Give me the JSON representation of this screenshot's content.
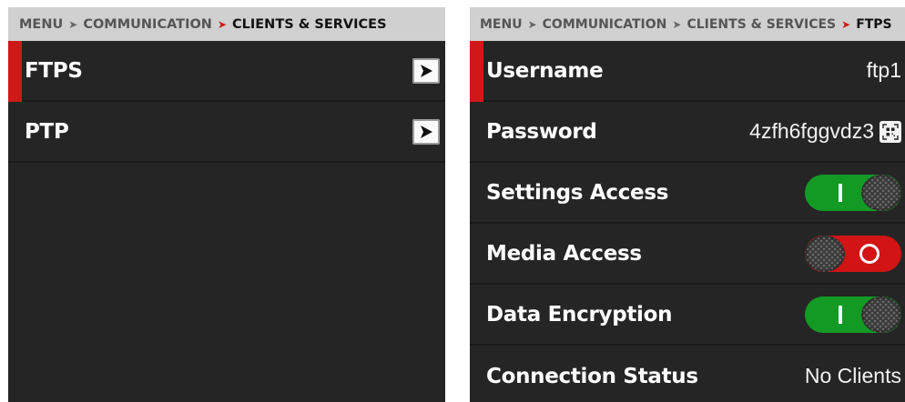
{
  "left": {
    "breadcrumb": {
      "items": [
        "MENU",
        "COMMUNICATION"
      ],
      "current": "CLIENTS & SERVICES"
    },
    "rows": [
      {
        "label": "FTPS",
        "selected": true
      },
      {
        "label": "PTP",
        "selected": false
      }
    ]
  },
  "right": {
    "breadcrumb": {
      "items": [
        "MENU",
        "COMMUNICATION",
        "CLIENTS & SERVICES"
      ],
      "current": "FTPS"
    },
    "rows": [
      {
        "label": "Username",
        "value": "ftp1"
      },
      {
        "label": "Password",
        "value": "4zfh6fggvdz3",
        "icon": "qr-code-icon"
      },
      {
        "label": "Settings Access",
        "toggle": "on"
      },
      {
        "label": "Media Access",
        "toggle": "off"
      },
      {
        "label": "Data Encryption",
        "toggle": "on"
      },
      {
        "label": "Connection Status",
        "value": "No Clients"
      }
    ]
  },
  "colors": {
    "panel_bg": "#252525",
    "breadcrumb_bg": "#d0d0d0",
    "accent_red": "#d11818",
    "toggle_on": "#139a25",
    "toggle_off": "#d21414"
  }
}
